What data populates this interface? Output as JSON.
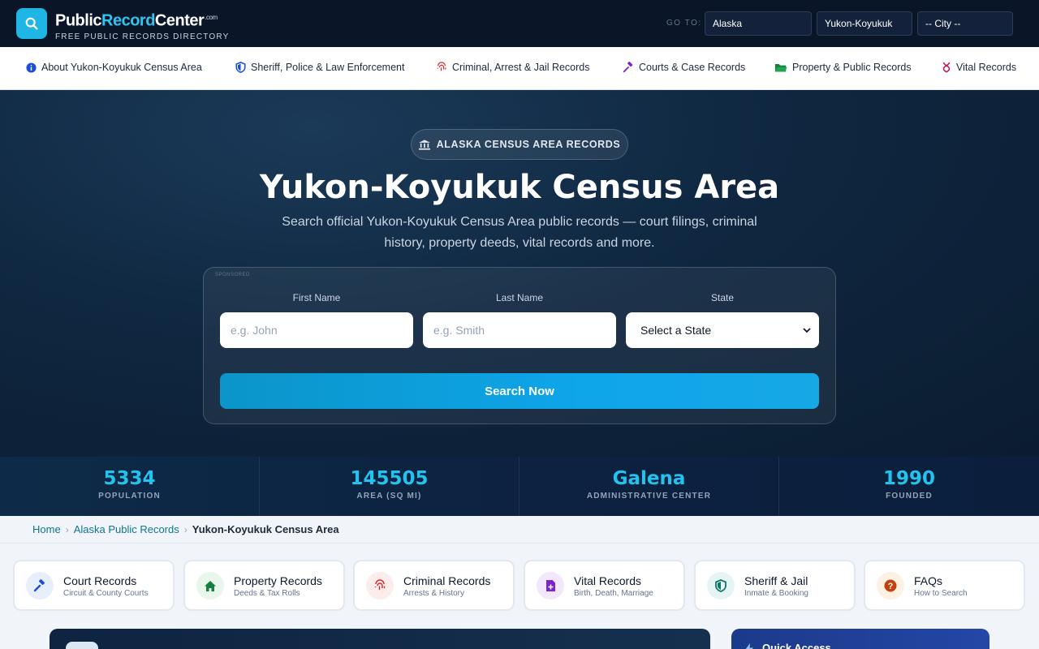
{
  "header": {
    "brand_primary": "Public",
    "brand_accent": "Record",
    "brand_secondary": "Center",
    "brand_suffix": ".com",
    "tagline": "FREE PUBLIC RECORDS DIRECTORY",
    "goto_label": "GO TO:",
    "state_select": "Alaska",
    "county_select": "Yukon-Koyukuk",
    "city_select": "-- City --"
  },
  "nav": {
    "items": [
      {
        "label": "About Yukon-Koyukuk Census Area",
        "icon": "info-icon"
      },
      {
        "label": "Sheriff, Police & Law Enforcement",
        "icon": "shield-icon"
      },
      {
        "label": "Criminal, Arrest & Jail Records",
        "icon": "fingerprint-icon"
      },
      {
        "label": "Courts & Case Records",
        "icon": "gavel-icon"
      },
      {
        "label": "Property & Public Records",
        "icon": "folder-icon"
      },
      {
        "label": "Vital Records",
        "icon": "dna-icon"
      }
    ]
  },
  "hero": {
    "pill": "ALASKA CENSUS AREA RECORDS",
    "title": "Yukon-Koyukuk Census Area",
    "subtitle": "Search official Yukon-Koyukuk Census Area public records — court filings, criminal history, property deeds, vital records and more."
  },
  "search": {
    "sponsored": "SPONSORED",
    "first_name_label": "First Name",
    "first_name_placeholder": "e.g. John",
    "last_name_label": "Last Name",
    "last_name_placeholder": "e.g. Smith",
    "state_label": "State",
    "state_value": "Select a State",
    "button": "Search Now"
  },
  "stats": [
    {
      "value": "5334",
      "label": "POPULATION"
    },
    {
      "value": "145505",
      "label": "AREA (SQ MI)"
    },
    {
      "value": "Galena",
      "label": "ADMINISTRATIVE CENTER"
    },
    {
      "value": "1990",
      "label": "FOUNDED"
    }
  ],
  "breadcrumb": {
    "home": "Home",
    "state": "Alaska Public Records",
    "current": "Yukon-Koyukuk Census Area"
  },
  "categories": [
    {
      "title": "Court Records",
      "sub": "Circuit & County Courts",
      "icon": "gavel-icon",
      "color": "#1d4ed8",
      "bg": "#e8effc"
    },
    {
      "title": "Property Records",
      "sub": "Deeds & Tax Rolls",
      "icon": "home-icon",
      "color": "#15803d",
      "bg": "#e8f6ec"
    },
    {
      "title": "Criminal Records",
      "sub": "Arrests & History",
      "icon": "fingerprint-icon",
      "color": "#dc2626",
      "bg": "#fdecec"
    },
    {
      "title": "Vital Records",
      "sub": "Birth, Death, Marriage",
      "icon": "file-plus-icon",
      "color": "#7e22ce",
      "bg": "#f3e8fb"
    },
    {
      "title": "Sheriff & Jail",
      "sub": "Inmate & Booking",
      "icon": "shield-icon",
      "color": "#0f766e",
      "bg": "#e6f5f3"
    },
    {
      "title": "FAQs",
      "sub": "How to Search",
      "icon": "question-icon",
      "color": "#c2410c",
      "bg": "#fdf1e4"
    }
  ],
  "quick_access": {
    "title": "Quick Access"
  },
  "colors": {
    "accent": "#22c3ee",
    "header_bg": "#0a1628",
    "hero_bg": "#0f2740",
    "button": "#0ea5e9"
  }
}
